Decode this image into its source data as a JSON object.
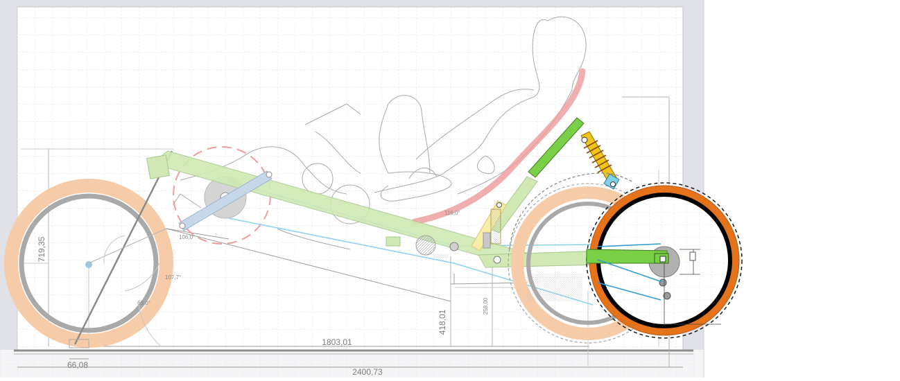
{
  "dimensions": {
    "total_length": "2400,73",
    "wheelbase": "1803,01",
    "front_overhang": "66,08",
    "front_height": "719,35",
    "seat_height": "418,01",
    "pivot_height": "258,00"
  },
  "angles": {
    "head_angle": "63,0°",
    "fork_angle": "107,7°",
    "crank_angle": "106,0°",
    "seat_angle": "116,0°"
  },
  "colors": {
    "frame": "#cfe8b4",
    "tire_front": "#f6cba8",
    "tire_rear": "#e5731b",
    "rim": "#a9a9a9",
    "chain": "#8fd3ee",
    "seat": "#ec9a9a",
    "swingarm": "#79cf45"
  }
}
